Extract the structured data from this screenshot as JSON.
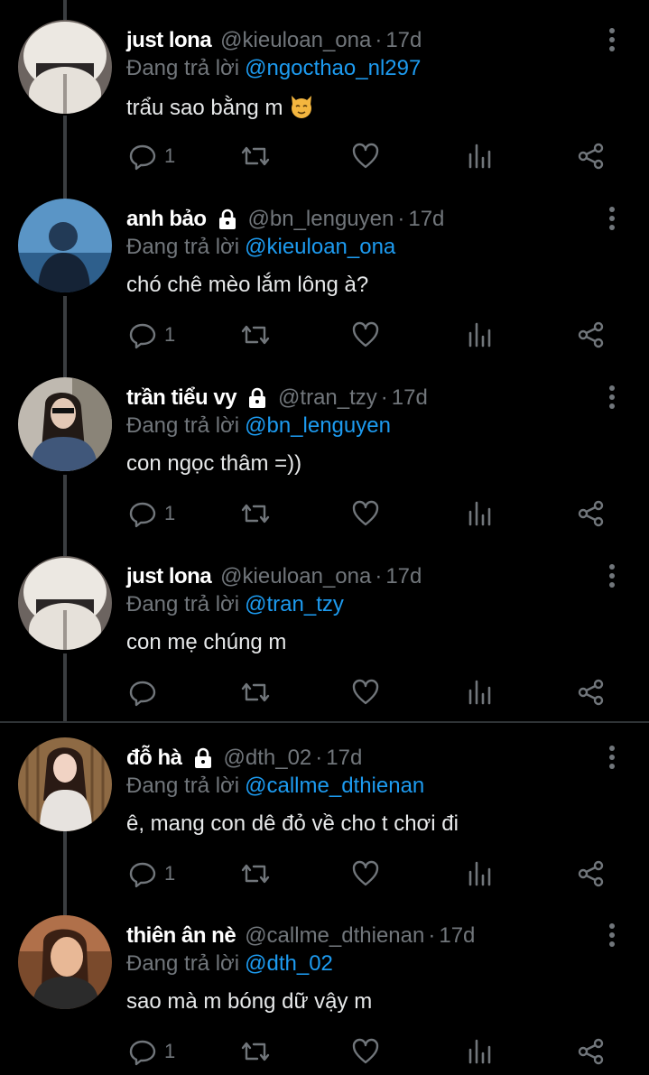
{
  "reply_prefix": "Đang trả lời",
  "tweets": [
    {
      "name": "just lona",
      "locked": false,
      "handle": "@kieuloan_ona",
      "time": "17d",
      "reply_to": "@ngocthao_nl297",
      "text": "trẩu sao bằng m",
      "emoji": "cat-face-emoji",
      "reply_count": "1",
      "avatar": "avatar-white-hat"
    },
    {
      "name": "anh bảo",
      "locked": true,
      "handle": "@bn_lenguyen",
      "time": "17d",
      "reply_to": "@kieuloan_ona",
      "text": "chó chê mèo lắm lông à?",
      "emoji": "",
      "reply_count": "1",
      "avatar": "avatar-blue-sea"
    },
    {
      "name": "trần tiểu vy",
      "locked": true,
      "handle": "@tran_tzy",
      "time": "17d",
      "reply_to": "@bn_lenguyen",
      "text": "con ngọc thâm =))",
      "emoji": "",
      "reply_count": "1",
      "avatar": "avatar-denim"
    },
    {
      "name": "just lona",
      "locked": false,
      "handle": "@kieuloan_ona",
      "time": "17d",
      "reply_to": "@tran_tzy",
      "text": "con mẹ chúng m",
      "emoji": "",
      "reply_count": "",
      "avatar": "avatar-white-hat"
    },
    {
      "name": "đỗ hà",
      "locked": true,
      "handle": "@dth_02",
      "time": "17d",
      "reply_to": "@callme_dthienan",
      "text": "ê, mang con dê đỏ về cho t chơi đi",
      "emoji": "",
      "reply_count": "1",
      "avatar": "avatar-pink-outfit"
    },
    {
      "name": "thiên ân nè",
      "locked": false,
      "handle": "@callme_dthienan",
      "time": "17d",
      "reply_to": "@dth_02",
      "text": "sao mà m bóng dữ vậy m",
      "emoji": "",
      "reply_count": "1",
      "avatar": "avatar-brown-warm"
    }
  ],
  "colors": {
    "background": "#000000",
    "link": "#1d9bf0",
    "muted": "#71767b",
    "thread_line": "#3a3d40",
    "divider": "#2f3336"
  }
}
